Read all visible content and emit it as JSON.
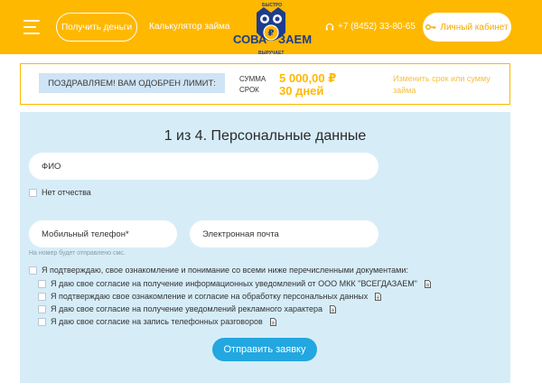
{
  "header": {
    "get_money_label": "Получить деньги",
    "calculator_label": "Калькулятор займа",
    "logo": {
      "left": "СОВА",
      "right": "ЗАЕМ",
      "top_text": "БЫСТРО",
      "bottom_text": "ВЫРУЧАЕТ"
    },
    "phone": "+7 (8452) 33-80-65",
    "cabinet_label": "Личный кабинет"
  },
  "approval": {
    "badge": "ПОЗДРАВЛЯЕМ! ВАМ ОДОБРЕН ЛИМИТ:",
    "sum_label": "СУММА",
    "term_label": "СРОК",
    "sum_value": "5 000,00 ₽",
    "term_value": "30 дней",
    "change_link": "Изменить срок или сумму займа"
  },
  "form": {
    "title": "1 из 4. Персональные данные",
    "fio_placeholder": "ФИО",
    "no_patronymic_label": "Нет отчества",
    "phone_placeholder": "Мобильный телефон*",
    "email_placeholder": "Электронная почта",
    "sms_hint": "На номер будет отправлено смс.",
    "consent_main": "Я подтверждаю, свое ознакомление и понимание со всеми ниже перечисленными документами:",
    "consents": [
      "Я даю свое согласие на получение информационных уведомлений от ООО МКК \"ВСЕГДАЗАЕМ\"",
      "Я подтверждаю свое ознакомление и согласие на обработку персональных данных",
      "Я даю свое согласие на получение уведомлений рекламного характера",
      "Я даю свое согласие на запись телефонных разговоров"
    ],
    "submit_label": "Отправить заявку"
  },
  "colors": {
    "brand_yellow": "#FFB800",
    "brand_blue": "#1E3C8C",
    "form_bg": "#D6EDF8",
    "submit_blue": "#22A7E0"
  }
}
